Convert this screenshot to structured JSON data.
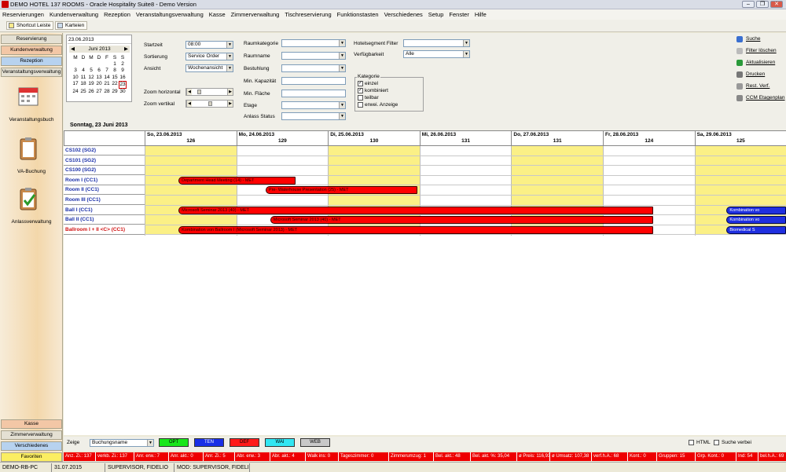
{
  "window": {
    "title": "DEMO HOTEL 137 ROOMS - Oracle Hospitality Suite8 - Demo Version",
    "minimize": "–",
    "restore": "❐",
    "close": "✕"
  },
  "menu": [
    "Reservierungen",
    "Kundenverwaltung",
    "Rezeption",
    "Veranstaltungsverwaltung",
    "Kasse",
    "Zimmerverwaltung",
    "Tischreservierung",
    "Funktionstasten",
    "Verschiedenes",
    "Setup",
    "Fenster",
    "Hilfe"
  ],
  "toolbar": {
    "shortcut": "Shortcut Leiste",
    "karteien": "Karteien"
  },
  "nav": {
    "top": [
      "Reservierung",
      "Kundenverwaltung",
      "Rezeption",
      "Veranstaltungsverwaltung"
    ],
    "icons": [
      {
        "label": "Veranstaltungsbuch",
        "icon": "calendar-book-icon"
      },
      {
        "label": "VA-Buchung",
        "icon": "clipboard-icon"
      },
      {
        "label": "Anlassverwaltung",
        "icon": "clipboard-check-icon"
      }
    ],
    "bottom": [
      "Kasse",
      "Zimmerverwaltung",
      "Verschiedenes",
      "Favoriten"
    ]
  },
  "calendar": {
    "date_value": "23.06.2013",
    "month": "Juni 2013",
    "weekdays": [
      "M",
      "D",
      "M",
      "D",
      "F",
      "S",
      "S"
    ],
    "days": [
      "",
      "",
      "",
      "",
      "",
      "1",
      "2",
      "3",
      "4",
      "5",
      "6",
      "7",
      "8",
      "9",
      "10",
      "11",
      "12",
      "13",
      "14",
      "15",
      "16",
      "17",
      "18",
      "19",
      "20",
      "21",
      "22",
      "23",
      "24",
      "25",
      "26",
      "27",
      "28",
      "29",
      "30",
      "",
      "",
      "",
      "",
      "",
      ""
    ]
  },
  "filters": {
    "startzeit_label": "Startzeit",
    "startzeit": "08:00",
    "sortierung_label": "Sortierung",
    "sortierung": "Service Order",
    "ansicht_label": "Ansicht",
    "ansicht": "Wochenansicht",
    "zoom_h_label": "Zoom horizontal",
    "zoom_v_label": "Zoom vertikal",
    "raumkategorie_label": "Raumkategorie",
    "raumname_label": "Raumname",
    "bestuhlung_label": "Bestuhlung",
    "min_kap_label": "Min. Kapazität",
    "min_flaeche_label": "Min. Fläche",
    "etage_label": "Etage",
    "anlass_label": "Anlass Status",
    "hotelsegment_label": "Hotelsegment Filter",
    "verfuegbarkeit_label": "Verfügbarkeit",
    "verfuegbarkeit": "Alle",
    "kategorie_label": "Kategorie",
    "kategorie": [
      {
        "label": "einzel",
        "checked": true
      },
      {
        "label": "kombiniert",
        "checked": true
      },
      {
        "label": "teilbar",
        "checked": false
      },
      {
        "label": "erwei. Anzeige",
        "checked": false
      }
    ]
  },
  "actions": [
    {
      "label": "Suche",
      "icon": "search-icon",
      "color": "#3a6fd0"
    },
    {
      "label": "Filter löschen",
      "icon": "filter-clear-icon",
      "color": "#bbbbbb"
    },
    {
      "label": "Aktualisieren",
      "icon": "refresh-icon",
      "color": "#2a9a3a"
    },
    {
      "label": "Drucken",
      "icon": "print-icon",
      "color": "#777777"
    },
    {
      "label": "Rest. Verf.",
      "icon": "restaurant-icon",
      "color": "#999999"
    },
    {
      "label": "CCM Etagenplan",
      "icon": "floorplan-icon",
      "color": "#888888"
    }
  ],
  "current_date": "Sonntag, 23 Juni 2013",
  "days": [
    {
      "date": "So, 23.06.2013",
      "num": "126",
      "yellow": true
    },
    {
      "date": "Mo, 24.06.2013",
      "num": "129",
      "yellow": false
    },
    {
      "date": "Di, 25.06.2013",
      "num": "130",
      "yellow": true
    },
    {
      "date": "Mi, 26.06.2013",
      "num": "131",
      "yellow": false
    },
    {
      "date": "Do, 27.06.2013",
      "num": "131",
      "yellow": true
    },
    {
      "date": "Fr, 28.06.2013",
      "num": "124",
      "yellow": false
    },
    {
      "date": "Sa, 29.06.2013",
      "num": "125",
      "yellow": true
    }
  ],
  "rooms": [
    {
      "name": "CS102 (SG2)",
      "color": "#1a2fa8"
    },
    {
      "name": "CS101 (SG2)",
      "color": "#1a2fa8"
    },
    {
      "name": "CS100 (SG2)",
      "color": "#1a2fa8"
    },
    {
      "name": "Room I (CC1)",
      "color": "#1a2fa8"
    },
    {
      "name": "Room II (CC1)",
      "color": "#1a2fa8"
    },
    {
      "name": "Room III (CC1)",
      "color": "#1a2fa8"
    },
    {
      "name": "Ball I (CC1)",
      "color": "#1a2fa8"
    },
    {
      "name": "Ball II (CC1)",
      "color": "#1a2fa8"
    },
    {
      "name": "Ballroom I + II   <C> (CC1)",
      "color": "#d01010"
    }
  ],
  "bookings": [
    {
      "row": 3,
      "start_day": 0.37,
      "end_day": 1.65,
      "text": "Department Head Meeting (14) - MET",
      "status": "DEF"
    },
    {
      "row": 4,
      "start_day": 1.32,
      "end_day": 2.98,
      "text": "Pre- Waterhouse Presentation (25) - MET",
      "status": "DEF"
    },
    {
      "row": 6,
      "start_day": 0.37,
      "end_day": 5.55,
      "text": "Microsoft Seminar 2013 (40) - MET",
      "status": "DEF"
    },
    {
      "row": 7,
      "start_day": 1.37,
      "end_day": 5.55,
      "text": "Microsoft Seminar 2013 (40) - MET",
      "status": "DEF"
    },
    {
      "row": 8,
      "start_day": 0.37,
      "end_day": 5.55,
      "text": "Kombination von Ballroom I (Microsoft Seminar 2013) - MET",
      "status": "DEF"
    },
    {
      "row": 6,
      "start_day": 6.35,
      "end_day": 7.0,
      "text": "Kombination vo",
      "status": "TEN"
    },
    {
      "row": 7,
      "start_day": 6.35,
      "end_day": 7.0,
      "text": "Kombination vo",
      "status": "TEN"
    },
    {
      "row": 8,
      "start_day": 6.35,
      "end_day": 7.0,
      "text": "Biomedical S",
      "status": "TEN"
    }
  ],
  "legend": {
    "zeige_label": "Zeige",
    "zeige_value": "Buchungsname",
    "statuses": [
      {
        "label": "OPT",
        "color": "#19e619"
      },
      {
        "label": "TEN",
        "color": "#1a2fe6"
      },
      {
        "label": "DEF",
        "color": "#ff1a1a"
      },
      {
        "label": "WAI",
        "color": "#33e6f2"
      },
      {
        "label": "WEB",
        "color": "#c8c8c8"
      }
    ],
    "html_label": "HTML",
    "suche_label": "Suche verbei"
  },
  "stats": [
    "Anz. Zi.: 137",
    "verkb. Zi.: 137",
    "Anr. erw.: 7",
    "Anr. akt.: 0",
    "Anr. Zi.: 5",
    "Abr. erw.: 3",
    "Abr. akt.: 4",
    "Walk ins: 0",
    "Tageszimmer: 0",
    "Zimmerumzug: 1",
    "Bel. akt.: 48",
    "Bel. akt. %: 35,04",
    "ø Preis: 116,93",
    "ø Umsatz: 107,38",
    "verf.h.A.: 68",
    "Kont.: 0",
    "Gruppen: 15",
    "Grp. Kont.: 0",
    "Ind: 54",
    "bel.h.A.: 69"
  ],
  "status": {
    "pc": "DEMO-RB-PC",
    "date": "31.07.2015",
    "user": "SUPERVISOR, FIDELIO",
    "mod": "MOD: SUPERVISOR, FIDELI"
  }
}
